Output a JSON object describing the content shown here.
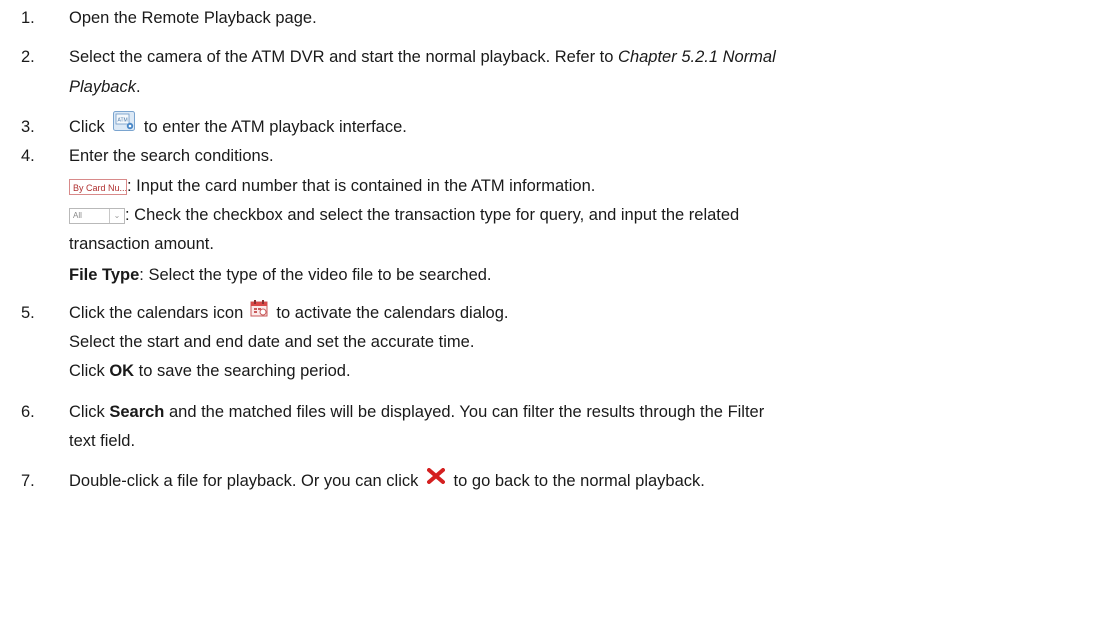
{
  "steps": [
    {
      "number": "1.",
      "text": "Open the Remote Playback page."
    },
    {
      "number": "2.",
      "text_a": "Select the camera of the ATM DVR and start the normal playback. Refer to ",
      "ref_a": "Chapter 5.2.1 Normal",
      "ref_b": "Playback",
      "text_b": "."
    },
    {
      "number": "3.",
      "text_a": "Click ",
      "icon": "atm-playback-icon",
      "text_b": " to enter the ATM playback interface."
    },
    {
      "number": "4.",
      "text": "Enter the search conditions.",
      "card": {
        "control_label": "By Card Nu...",
        "text": ": Input the card number that is contained in the ATM information."
      },
      "type": {
        "control_label": "All",
        "text_a": ": Check the checkbox and select the transaction type for query, and input the related",
        "text_b": "transaction amount."
      },
      "file_type": {
        "label": "File Type",
        "text": ": Select the type of the video file to be searched."
      }
    },
    {
      "number": "5.",
      "text_a": "Click the calendars icon ",
      "icon": "calendar-icon",
      "text_b": " to activate the calendars dialog.",
      "line2": "Select the start and end date and set the accurate time.",
      "line3_a": "Click ",
      "line3_bold": "OK",
      "line3_b": " to save the searching period."
    },
    {
      "number": "6.",
      "text_a": "Click ",
      "bold": "Search",
      "text_b": " and the matched files will be displayed. You can filter the results through the Filter",
      "text_c": "text field."
    },
    {
      "number": "7.",
      "text_a": "Double-click a file for playback. Or you can click ",
      "icon": "close-icon",
      "text_b": " to go back to the normal playback."
    }
  ],
  "colors": {
    "text": "#1a1a1a",
    "close_red": "#d42020",
    "icon_blue": "#4a88c8"
  }
}
